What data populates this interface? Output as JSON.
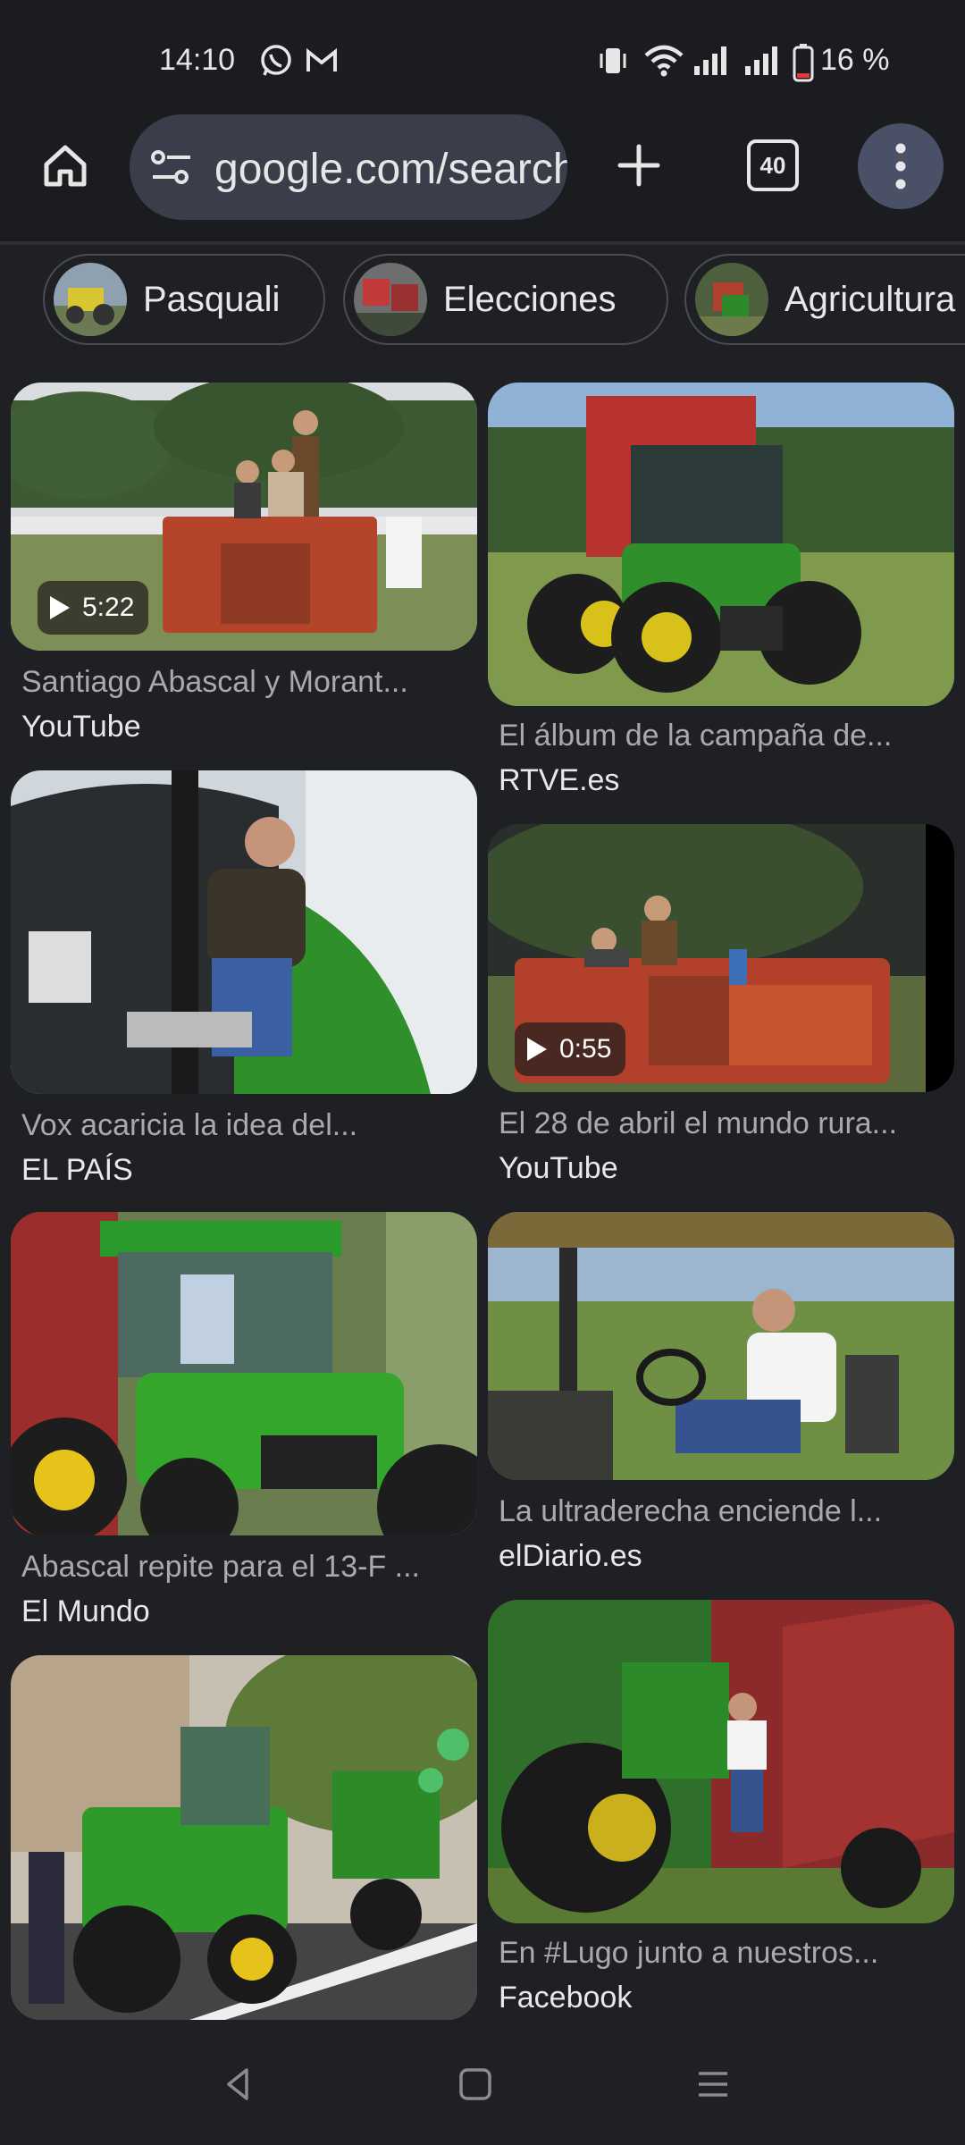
{
  "status_bar": {
    "time": "14:10",
    "battery_text": "16 %",
    "left_icons": [
      "whatsapp-icon",
      "gmail-icon"
    ],
    "right_icons": [
      "vibrate-icon",
      "wifi-icon",
      "signal-icon",
      "signal-icon",
      "battery-icon"
    ]
  },
  "toolbar": {
    "url": "google.com/search",
    "tab_count": "40"
  },
  "chips": [
    {
      "label": "Pasquali"
    },
    {
      "label": "Elecciones"
    },
    {
      "label": "Agricultura"
    }
  ],
  "results": [
    {
      "caption": "Santiago Abascal y Morant...",
      "source": "YouTube",
      "duration": "5:22"
    },
    {
      "caption": "El álbum de la campaña de...",
      "source": "RTVE.es"
    },
    {
      "caption": "Vox acaricia la idea del...",
      "source": "EL PAÍS"
    },
    {
      "caption": "El 28 de abril el mundo rura...",
      "source": "YouTube",
      "duration": "0:55"
    },
    {
      "caption": "Abascal repite para el 13-F ...",
      "source": "El Mundo"
    },
    {
      "caption": "La ultraderecha enciende l...",
      "source": "elDiario.es"
    },
    {
      "caption": "",
      "source": ""
    },
    {
      "caption": "En #Lugo junto a nuestros...",
      "source": "Facebook"
    }
  ],
  "colors": {
    "background": "#1f2024",
    "omnibox": "#3a3e4a",
    "tractor_green": "#2f8f2a",
    "tractor_red": "#b5452a"
  }
}
